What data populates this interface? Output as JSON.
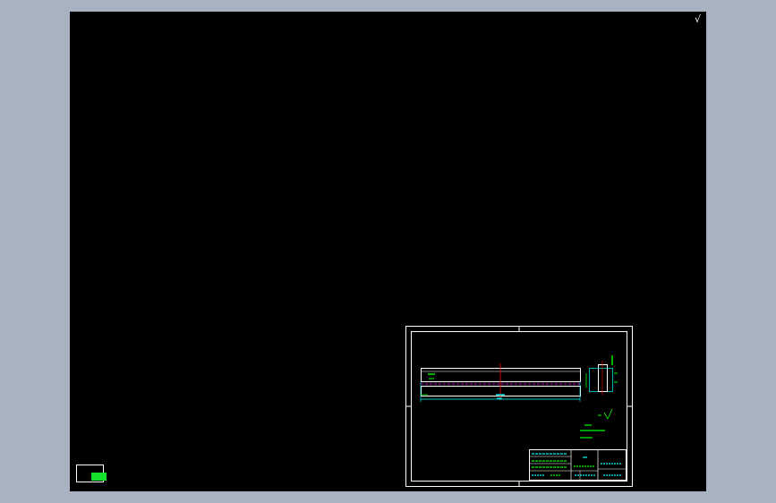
{
  "app": {
    "corner_symbol": "√"
  },
  "colors": {
    "desktop_bg": "#a9b2c0",
    "canvas_bg": "#000000",
    "frame": "#ffffff",
    "geometry": "#ffffff",
    "dimension": "#00ffff",
    "centerline": "#ff0000",
    "hidden": "#ff00ff",
    "annotation": "#00ff00",
    "title_block_text": "#00ffff",
    "model_tab_fill": "#15e02a"
  },
  "icons": {
    "view_cube": "check-icon",
    "layout_tab": "model-tab-icon"
  }
}
